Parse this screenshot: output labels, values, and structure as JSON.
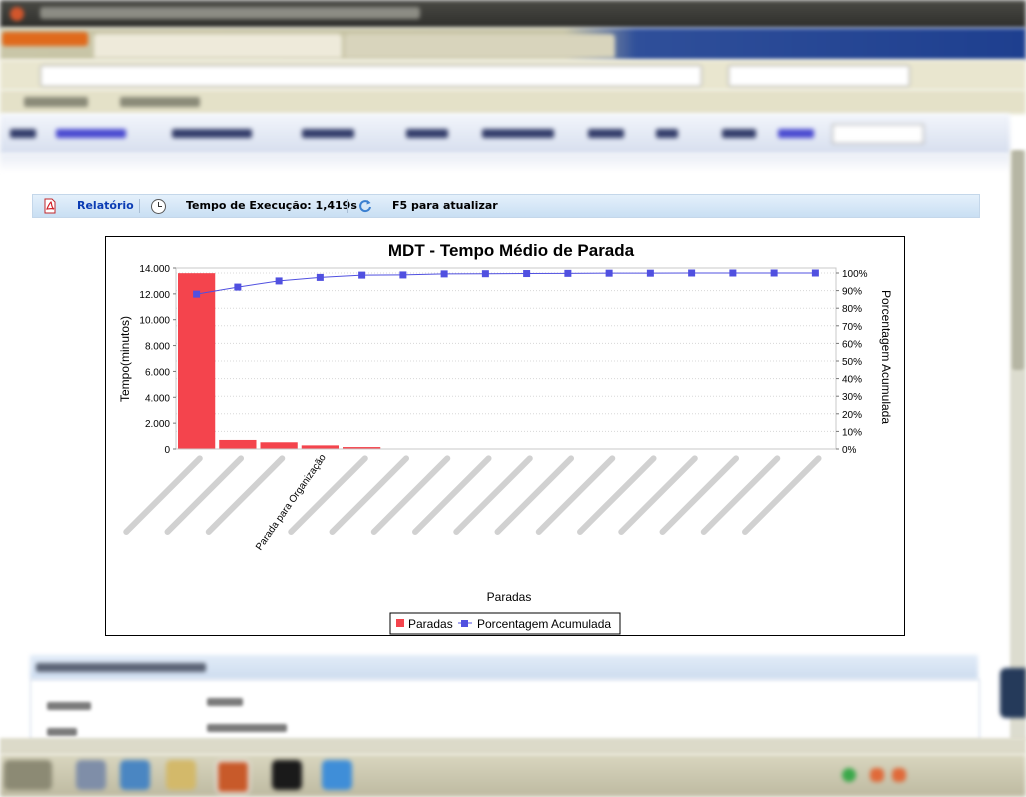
{
  "toolbar": {
    "report_label": "Relatório",
    "exec_time_label": "Tempo de Execução: 1,419s",
    "refresh_hint": "F5 para atualizar"
  },
  "icons": {
    "report": "pdf-icon",
    "exec_time": "clock-icon",
    "refresh": "refresh-icon"
  },
  "chart_data": {
    "type": "bar",
    "title": "MDT - Tempo Médio de Parada",
    "xlabel": "Paradas",
    "ylabel": "Tempo(minutos)",
    "y2label": "Porcentagem Acumulada",
    "ylim": [
      0,
      14000
    ],
    "y_ticks": [
      "0",
      "2.000",
      "4.000",
      "6.000",
      "8.000",
      "10.000",
      "12.000",
      "14.000"
    ],
    "y2lim": [
      0,
      100
    ],
    "y2_ticks": [
      "0%",
      "10%",
      "20%",
      "30%",
      "40%",
      "50%",
      "60%",
      "70%",
      "80%",
      "90%",
      "100%"
    ],
    "categories": [
      "",
      "",
      "",
      "Parada para Organização",
      "",
      "",
      "",
      "",
      "",
      "",
      "",
      "",
      "",
      "",
      "",
      ""
    ],
    "series": [
      {
        "name": "Paradas",
        "kind": "bar",
        "color": "#f4444d",
        "values": [
          13600,
          700,
          520,
          280,
          150,
          0,
          0,
          0,
          0,
          0,
          0,
          0,
          0,
          0,
          0,
          0
        ]
      },
      {
        "name": "Porcentagem Acumulada",
        "kind": "line",
        "axis": "right",
        "color": "#5050e0",
        "values": [
          88,
          92,
          95.5,
          97.5,
          98.8,
          98.9,
          99.5,
          99.6,
          99.7,
          99.8,
          99.9,
          99.9,
          100,
          100,
          100,
          100
        ]
      }
    ],
    "grid": true,
    "legend": "bottom-center"
  }
}
